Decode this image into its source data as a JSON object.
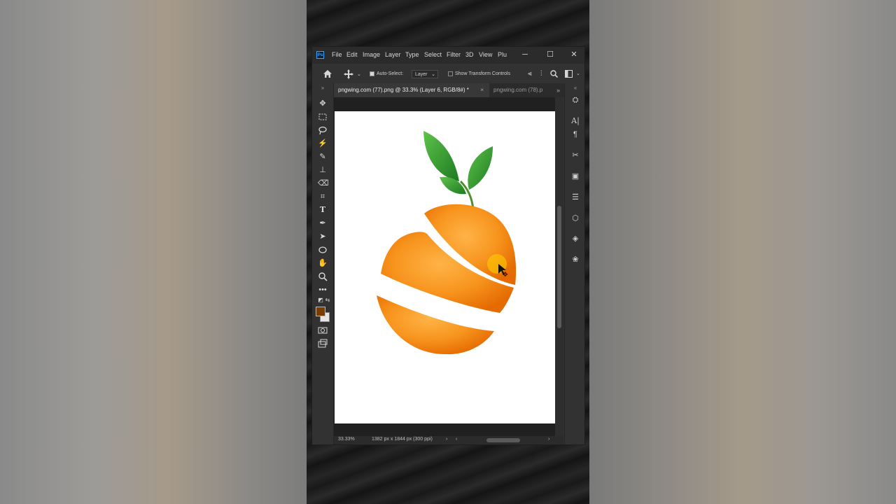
{
  "window": {
    "app_badge": "Ps",
    "menu": [
      "File",
      "Edit",
      "Image",
      "Layer",
      "Type",
      "Select",
      "Filter",
      "3D",
      "View",
      "Plu"
    ],
    "controls": {
      "minimize": "─",
      "maximize": "☐",
      "close": "✕"
    }
  },
  "options": {
    "auto_select_label": "Auto-Select:",
    "auto_select_checked": true,
    "layer_dropdown": "Layer",
    "show_transform_label": "Show Transform Controls",
    "show_transform_checked": false
  },
  "tabs": [
    {
      "label": "pngwing.com (77).png @ 33.3% (Layer 6, RGB/8#) *",
      "active": true,
      "close": "×"
    },
    {
      "label": "pngwing.com (78).p",
      "active": false
    }
  ],
  "status": {
    "zoom": "33.33%",
    "doc_info": "1382 px x 1844 px (300 ppi)"
  },
  "colors": {
    "foreground": "#7a3d00",
    "background": "#e6e6e6",
    "accent": "#31a8ff",
    "orange": "#f7941d"
  },
  "icons": {
    "tools": [
      "move-icon",
      "marquee-icon",
      "lasso-icon",
      "magic-wand-icon",
      "brush-icon",
      "stamp-icon",
      "eraser-icon",
      "crop-icon",
      "type-icon",
      "pen-icon",
      "selection-arrow-icon",
      "ellipse-icon",
      "hand-icon",
      "zoom-icon",
      "more-icon"
    ],
    "panels": [
      "libraries-icon",
      "character-icon",
      "paragraph-icon",
      "tools-icon",
      "swatches-icon",
      "adjustments-icon",
      "3d-icon",
      "layers-icon",
      "channels-icon"
    ]
  }
}
